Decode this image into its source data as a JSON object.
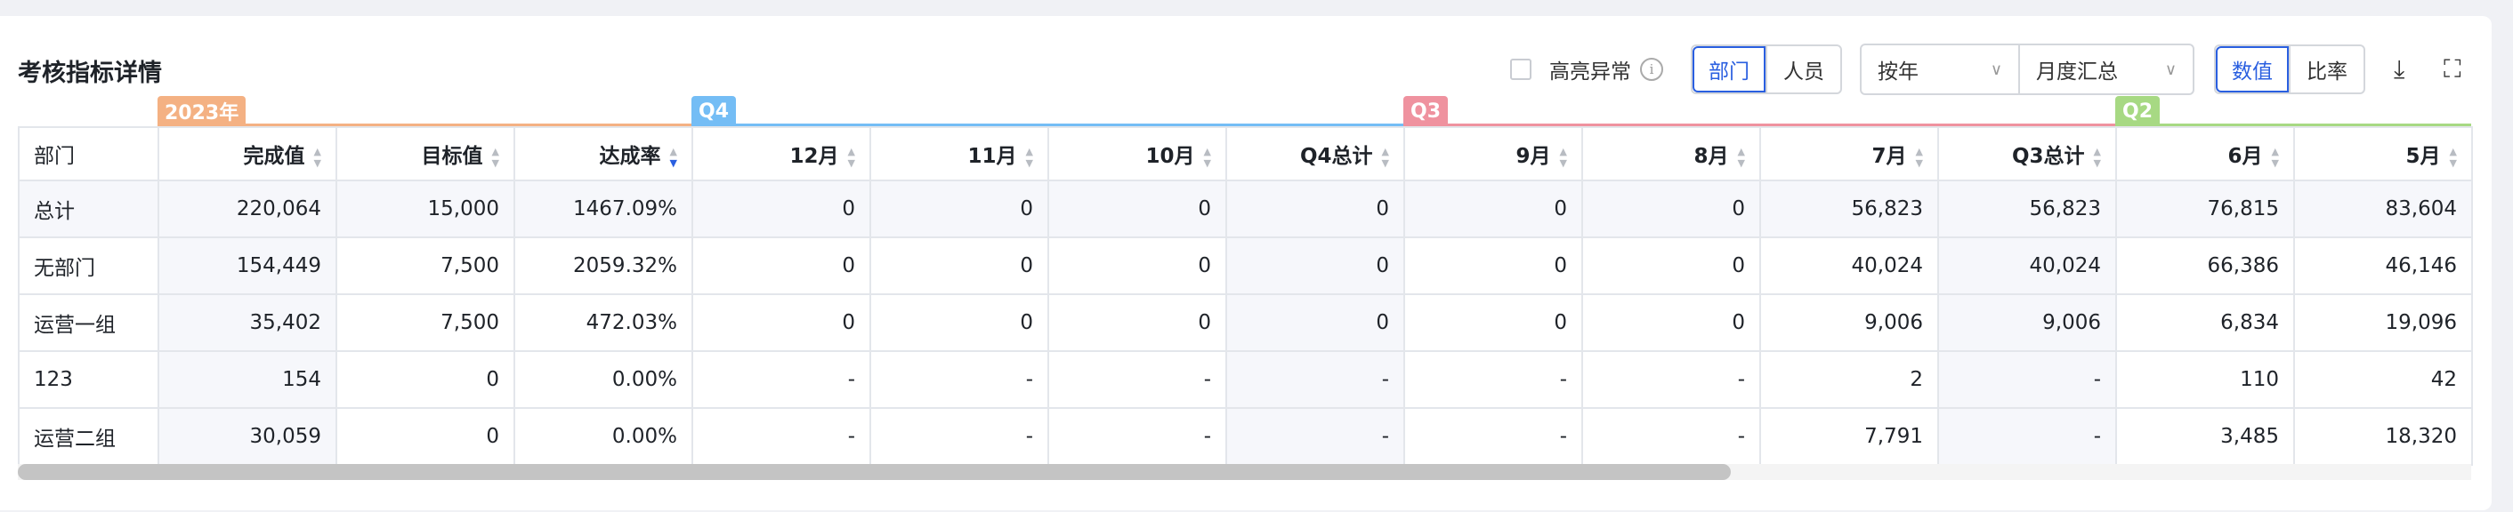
{
  "title": "考核指标详情",
  "toolbar": {
    "highlight_label": "高亮异常",
    "highlight_checked": false,
    "dim_options": [
      "部门",
      "人员"
    ],
    "dim_selected": "部门",
    "period": "按年",
    "summary": "月度汇总",
    "mode_options": [
      "数值",
      "比率"
    ],
    "mode_selected": "数值",
    "icons": [
      "download-icon",
      "fullscreen-icon"
    ]
  },
  "groups": [
    {
      "label": "2023年",
      "color": "#f4b183"
    },
    {
      "label": "Q4",
      "color": "#74bdf5"
    },
    {
      "label": "Q3",
      "color": "#ef929f"
    },
    {
      "label": "Q2",
      "color": "#a7d983"
    }
  ],
  "columns": [
    "部门",
    "完成值",
    "目标值",
    "达成率",
    "12月",
    "11月",
    "10月",
    "Q4总计",
    "9月",
    "8月",
    "7月",
    "Q3总计",
    "6月",
    "5月"
  ],
  "sort": {
    "column": "达成率",
    "direction": "descending"
  },
  "rows": [
    [
      "总计",
      "220,064",
      "15,000",
      "1467.09%",
      "0",
      "0",
      "0",
      "0",
      "0",
      "0",
      "56,823",
      "56,823",
      "76,815",
      "83,604"
    ],
    [
      "无部门",
      "154,449",
      "7,500",
      "2059.32%",
      "0",
      "0",
      "0",
      "0",
      "0",
      "0",
      "40,024",
      "40,024",
      "66,386",
      "46,146"
    ],
    [
      "运营一组",
      "35,402",
      "7,500",
      "472.03%",
      "0",
      "0",
      "0",
      "0",
      "0",
      "0",
      "9,006",
      "9,006",
      "6,834",
      "19,096"
    ],
    [
      "123",
      "154",
      "0",
      "0.00%",
      "-",
      "-",
      "-",
      "-",
      "-",
      "-",
      "2",
      "-",
      "110",
      "42"
    ],
    [
      "运营二组",
      "30,059",
      "0",
      "0.00%",
      "-",
      "-",
      "-",
      "-",
      "-",
      "-",
      "7,791",
      "-",
      "3,485",
      "18,320"
    ]
  ],
  "scroll_position_fraction": 0
}
